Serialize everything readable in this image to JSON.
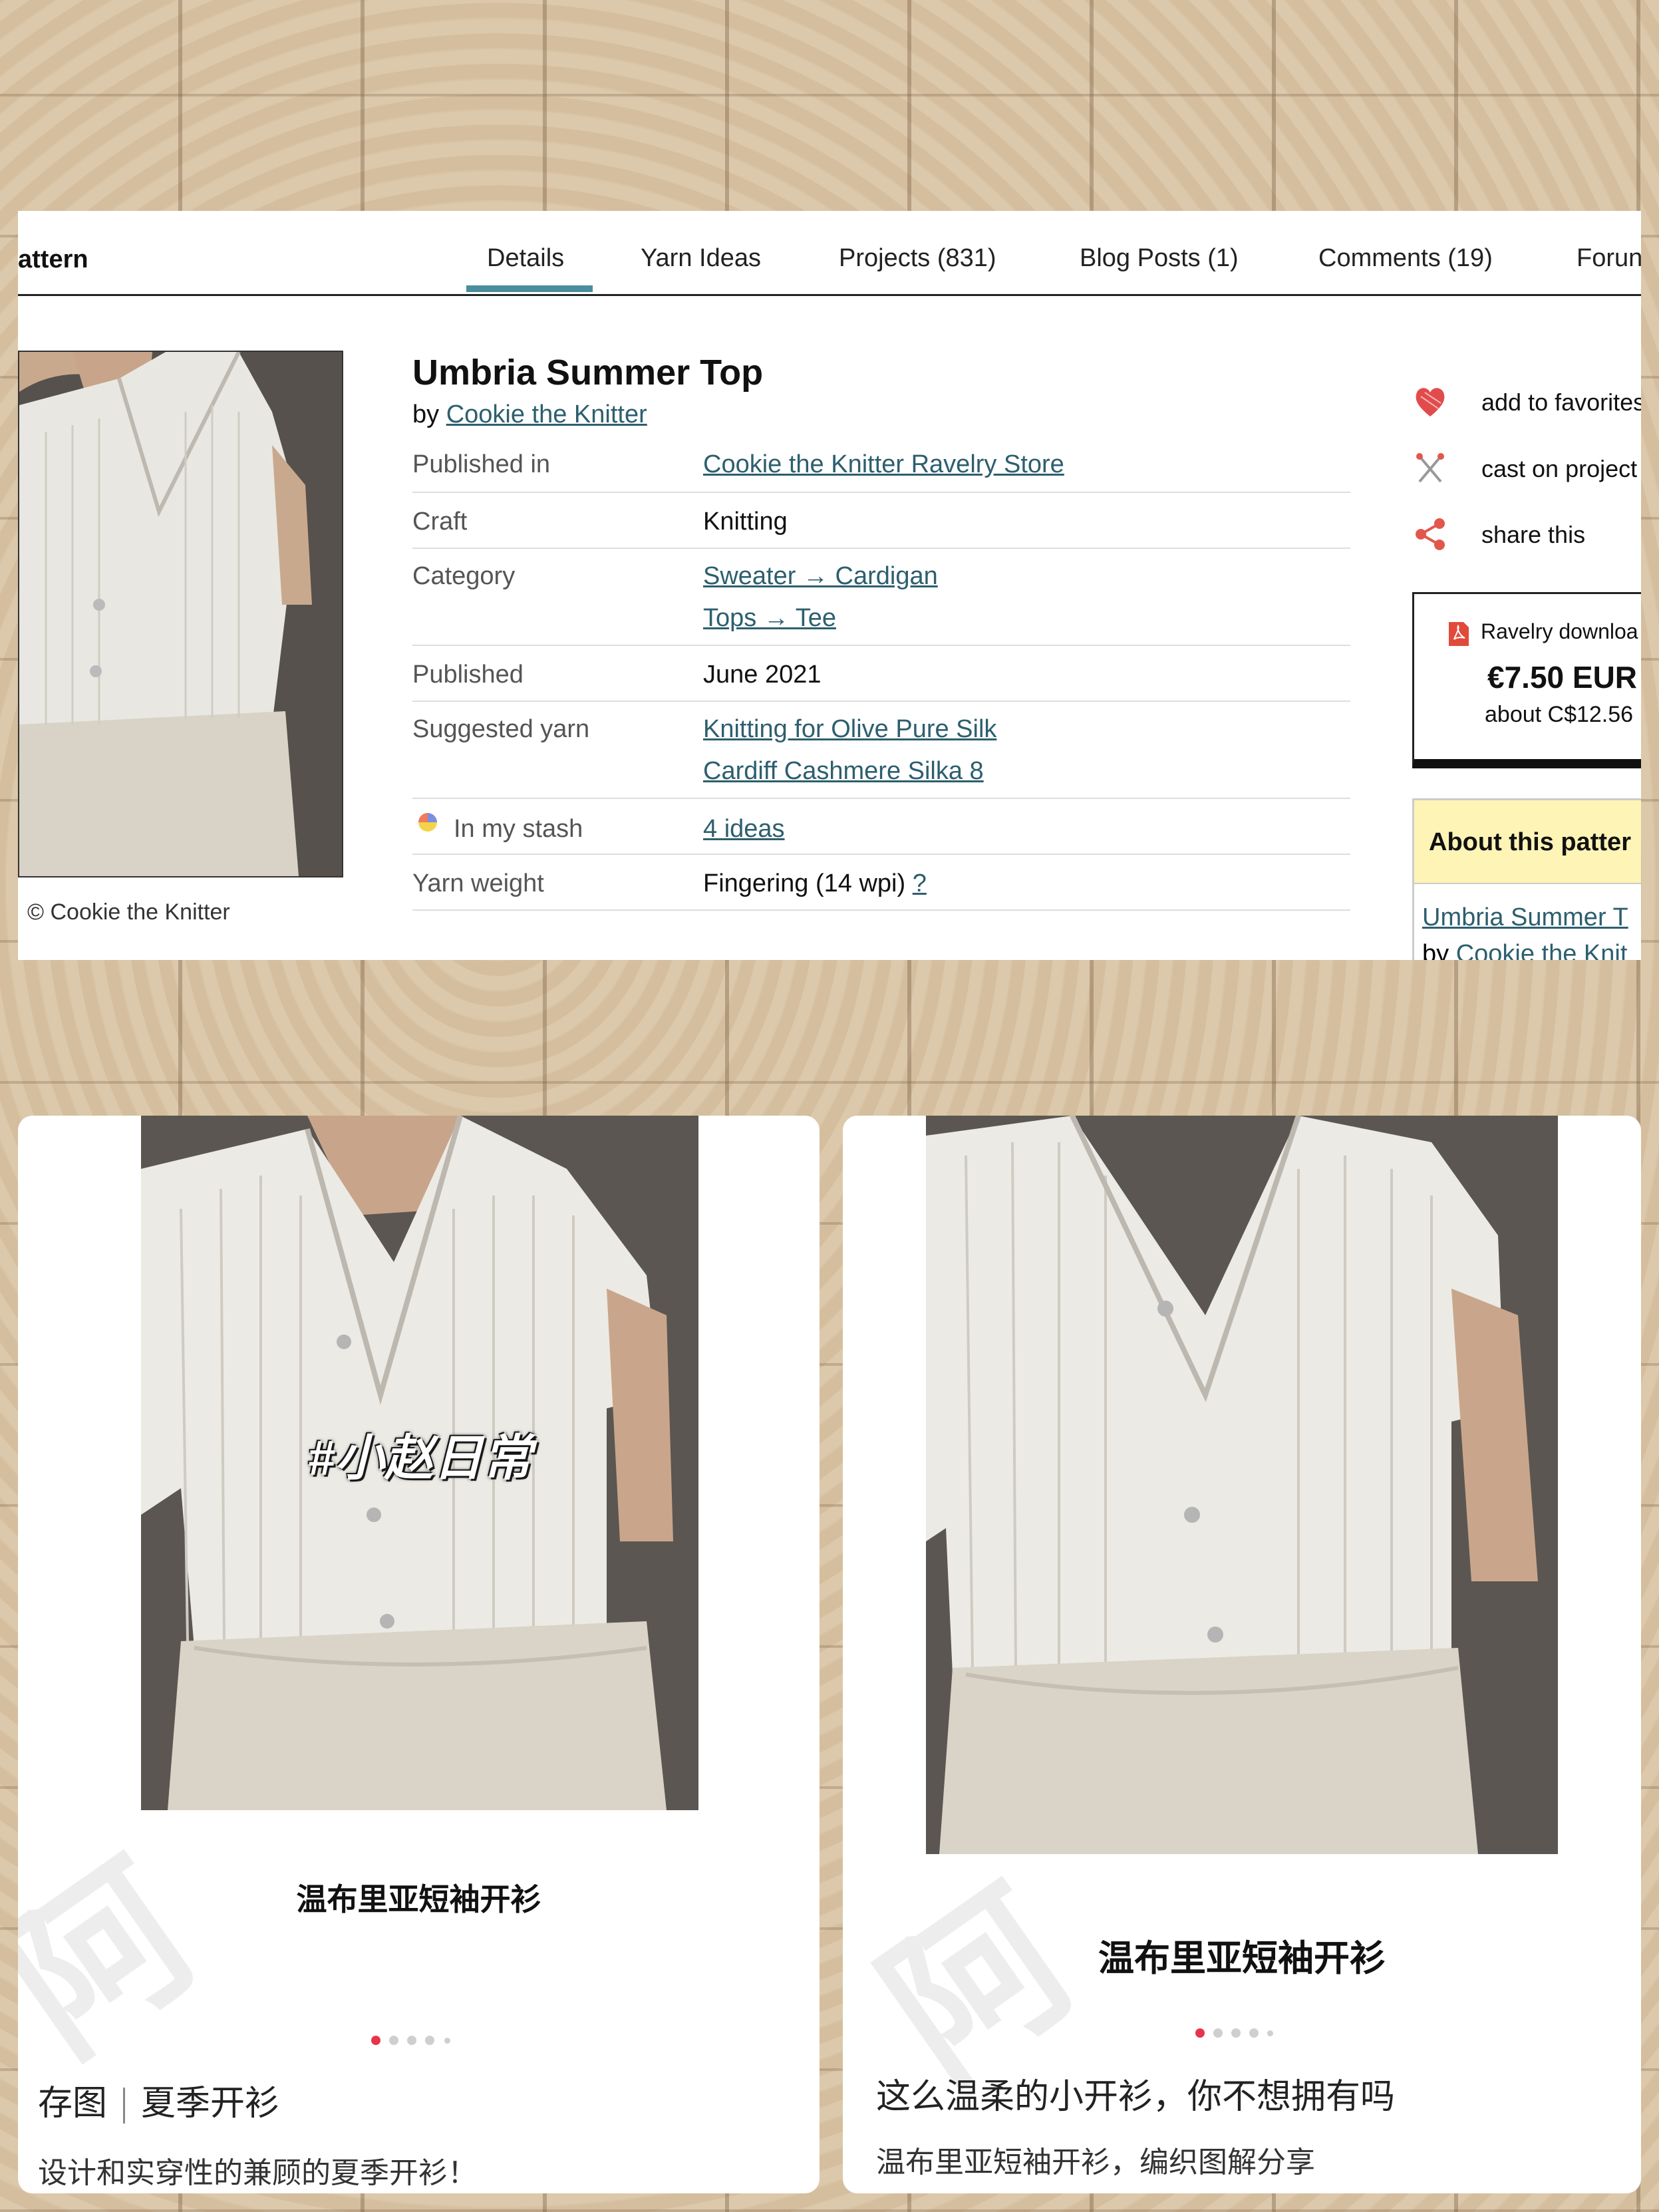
{
  "ravelry": {
    "brand_partial": "attern",
    "tabs": [
      {
        "label": "Details",
        "active": true
      },
      {
        "label": "Yarn Ideas"
      },
      {
        "label": "Projects (831)"
      },
      {
        "label": "Blog Posts (1)"
      },
      {
        "label": "Comments (19)"
      },
      {
        "label": "Forun"
      }
    ],
    "photo_credit": "© Cookie the Knitter",
    "pattern_title": "Umbria Summer Top",
    "by_prefix": "by",
    "designer": "Cookie the Knitter",
    "details": {
      "published_in": {
        "label": "Published in",
        "value": "Cookie the Knitter Ravelry Store"
      },
      "craft": {
        "label": "Craft",
        "value": "Knitting"
      },
      "category": {
        "label": "Category",
        "value1": "Sweater → Cardigan",
        "value2": "Tops → Tee"
      },
      "published": {
        "label": "Published",
        "value": "June 2021"
      },
      "suggested_yarn": {
        "label": "Suggested yarn",
        "value1": "Knitting for Olive Pure Silk",
        "value2": "Cardiff Cashmere Silka 8"
      },
      "in_my_stash": {
        "label": "In my stash",
        "value": "4 ideas"
      },
      "yarn_weight": {
        "label": "Yarn weight",
        "value": "Fingering (14 wpi)",
        "help": "?"
      }
    },
    "actions": {
      "favorites": "add to favorites",
      "cast_on": "cast on project",
      "share": "share this"
    },
    "purchase": {
      "download_label": "Ravelry downloa",
      "price": "€7.50 EUR",
      "about": "about C$12.56"
    },
    "about_box": {
      "header": "About this patter",
      "line1": "Umbria Summer T",
      "line2_prefix": "by",
      "line2_link": "Cookie the Knit"
    },
    "colors": {
      "accent": "#4a8d9c",
      "link": "#2d5f6e",
      "about_header_bg": "#fdf4b6",
      "heart": "#e24b4b"
    }
  },
  "card_left": {
    "hashtag": "#小赵日常",
    "caption": "温布里亚短袖开衫",
    "dots_total": 5,
    "dots_active": 0,
    "post_title_a": "存图",
    "post_title_b": "夏季开衫",
    "post_subtitle": "设计和实穿性的兼顾的夏季开衫！"
  },
  "card_right": {
    "caption": "温布里亚短袖开衫",
    "dots_total": 5,
    "dots_active": 0,
    "post_title": "这么温柔的小开衫，你不想拥有吗",
    "post_subtitle": "温布里亚短袖开衫，编织图解分享"
  }
}
